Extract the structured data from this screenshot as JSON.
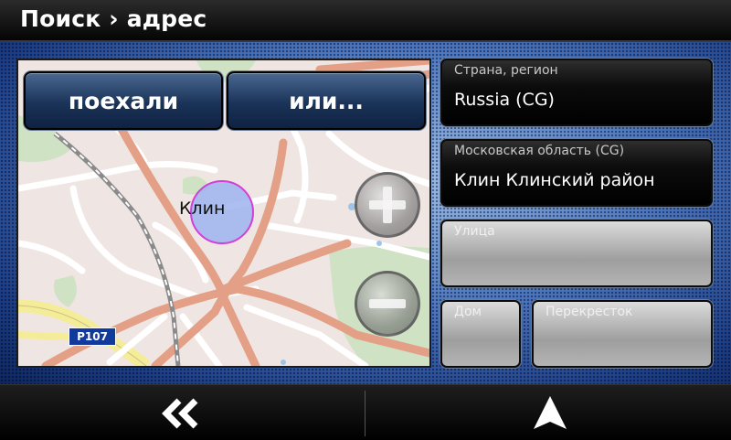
{
  "header": {
    "title": "Поиск › адрес"
  },
  "map": {
    "go_label": "поехали",
    "or_label": "или...",
    "city_label": "Клин",
    "road_badge": "P107"
  },
  "fields": {
    "country": {
      "label": "Страна, регион",
      "value": "Russia (CG)"
    },
    "region": {
      "label": "Московская область (CG)",
      "value": "Клин Клинский район"
    },
    "street": {
      "label": "Улица"
    },
    "house": {
      "label": "Дом"
    },
    "crossing": {
      "label": "Перекресток"
    }
  },
  "icons": {
    "back": "double-chevron-left-icon",
    "navigate": "navigation-arrow-icon",
    "zoom_in": "plus-icon",
    "zoom_out": "minus-icon"
  },
  "colors": {
    "background": "#1d3f87",
    "button": "#1a3358",
    "road": "#e4a087"
  }
}
